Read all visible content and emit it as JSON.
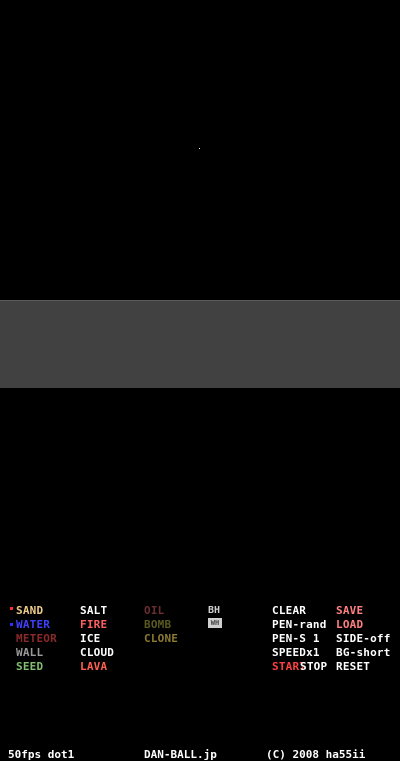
{
  "colors": {
    "sand": "#eecc88",
    "water": "#4040ff",
    "meteor": "#8a2a2a",
    "wall": "#9a9a9a",
    "seed": "#80c070",
    "salt": "#ffffff",
    "fire": "#ff6060",
    "ice": "#ffffff",
    "cloud": "#ffffff",
    "lava": "#ff6050",
    "oil": "#6a2e2e",
    "bomb": "#5c5a20",
    "clone": "#8c7a30",
    "white": "#ffffff",
    "red": "#ff4040",
    "pink": "#ff8080",
    "sel_red": "#ff3030",
    "sel_blue": "#3030ff",
    "panel": "#414141"
  },
  "elements": {
    "sand": "SAND",
    "water": "WATER",
    "meteor": "METEOR",
    "wall": "WALL",
    "seed": "SEED",
    "salt": "SALT",
    "fire": "FIRE",
    "ice": "ICE",
    "cloud": "CLOUD",
    "lava": "LAVA",
    "oil": "OIL",
    "bomb": "BOMB",
    "clone": "CLONE",
    "bh": "BH",
    "wh": "WH"
  },
  "controls": {
    "clear": "CLEAR",
    "pen": "PEN-rand",
    "pen_size": "PEN-S 1",
    "speed": "SPEEDx1",
    "start": "START",
    "stop": "STOP",
    "save": "SAVE",
    "load": "LOAD",
    "side": "SIDE-off",
    "bg": "BG-short",
    "reset": "RESET"
  },
  "status": {
    "fps": "50fps dot1",
    "site": "DAN-BALL.jp",
    "copyright": "(C) 2008 ha55ii"
  }
}
